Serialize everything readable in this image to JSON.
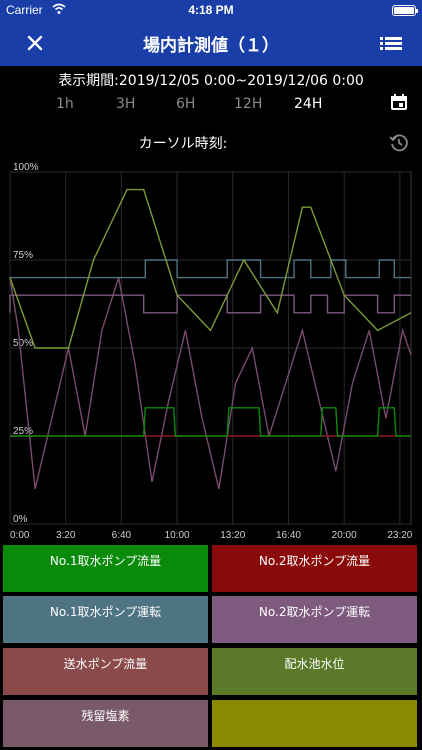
{
  "status_bar": {
    "carrier": "Carrier",
    "time": "4:18 PM"
  },
  "nav": {
    "title": "場内計測値（１）",
    "close_icon": "close-icon",
    "menu_icon": "list-icon"
  },
  "period": {
    "label": "表示期間:2019/12/05 0:00~2019/12/06 0:00"
  },
  "ranges": [
    {
      "label": "1h",
      "active": false
    },
    {
      "label": "3H",
      "active": false
    },
    {
      "label": "6H",
      "active": false
    },
    {
      "label": "12H",
      "active": false
    },
    {
      "label": "24H",
      "active": true
    }
  ],
  "cursor": {
    "label": "カーソル時刻:"
  },
  "icons": {
    "calendar": "calendar-icon",
    "refresh": "history-icon"
  },
  "chart_data": {
    "type": "line",
    "yticks": [
      "100%",
      "75%",
      "50%",
      "25%",
      "0%"
    ],
    "ylim": [
      0,
      100
    ],
    "xticks": [
      "0:00",
      "3:20",
      "6:40",
      "10:00",
      "13:20",
      "16:40",
      "20:00",
      "23:20"
    ],
    "xlim_hours": [
      0,
      24
    ],
    "grid": true,
    "series": [
      {
        "color": "#7a4a6e",
        "values_pct_at_hours": [
          [
            0,
            70
          ],
          [
            0.5,
            55
          ],
          [
            1.5,
            10
          ],
          [
            2.5,
            30
          ],
          [
            3.5,
            50
          ],
          [
            4.5,
            25
          ],
          [
            5.5,
            55
          ],
          [
            6.5,
            70
          ],
          [
            7.5,
            45
          ],
          [
            8.5,
            12
          ],
          [
            9.5,
            35
          ],
          [
            10.5,
            55
          ],
          [
            11.5,
            30
          ],
          [
            12.5,
            10
          ],
          [
            13.5,
            40
          ],
          [
            14.5,
            50
          ],
          [
            15.5,
            25
          ],
          [
            16.5,
            40
          ],
          [
            17.5,
            55
          ],
          [
            18.5,
            35
          ],
          [
            19.5,
            15
          ],
          [
            20.5,
            40
          ],
          [
            21.5,
            55
          ],
          [
            22.5,
            30
          ],
          [
            23.5,
            55
          ],
          [
            24,
            48
          ]
        ]
      },
      {
        "color": "#8a1a1a",
        "values_pct_at_hours": [
          [
            0,
            25
          ],
          [
            24,
            25
          ]
        ]
      },
      {
        "color": "#0a8a0a",
        "values_pct_at_hours": [
          [
            0,
            25
          ],
          [
            8,
            25
          ],
          [
            8.1,
            33
          ],
          [
            9.8,
            33
          ],
          [
            9.9,
            25
          ],
          [
            13,
            25
          ],
          [
            13.1,
            33
          ],
          [
            14.9,
            33
          ],
          [
            15,
            25
          ],
          [
            18.6,
            25
          ],
          [
            18.7,
            33
          ],
          [
            19.5,
            33
          ],
          [
            19.6,
            25
          ],
          [
            22,
            25
          ],
          [
            22.1,
            33
          ],
          [
            23,
            33
          ],
          [
            23.1,
            25
          ],
          [
            24,
            25
          ]
        ]
      },
      {
        "color": "#4e7382",
        "values_pct_at_hours": [
          [
            0,
            70
          ],
          [
            8.1,
            70
          ],
          [
            8.1,
            75
          ],
          [
            10,
            75
          ],
          [
            10,
            70
          ],
          [
            13,
            70
          ],
          [
            13,
            75
          ],
          [
            15,
            75
          ],
          [
            15,
            70
          ],
          [
            17,
            70
          ],
          [
            17,
            75
          ],
          [
            18,
            75
          ],
          [
            18,
            70
          ],
          [
            19.2,
            70
          ],
          [
            19.2,
            75
          ],
          [
            20.1,
            75
          ],
          [
            20.1,
            70
          ],
          [
            22.1,
            70
          ],
          [
            22.1,
            75
          ],
          [
            23,
            75
          ],
          [
            23,
            70
          ],
          [
            24,
            70
          ]
        ]
      },
      {
        "color": "#7d5a7e",
        "values_pct_at_hours": [
          [
            0,
            60
          ],
          [
            0,
            65
          ],
          [
            8,
            65
          ],
          [
            8,
            60
          ],
          [
            10,
            60
          ],
          [
            10,
            65
          ],
          [
            13,
            65
          ],
          [
            13,
            60
          ],
          [
            15,
            60
          ],
          [
            15,
            65
          ],
          [
            17,
            65
          ],
          [
            17,
            60
          ],
          [
            18,
            60
          ],
          [
            18,
            65
          ],
          [
            19,
            65
          ],
          [
            19,
            60
          ],
          [
            20,
            60
          ],
          [
            20,
            65
          ],
          [
            22,
            65
          ],
          [
            22,
            60
          ],
          [
            23,
            60
          ],
          [
            23,
            65
          ],
          [
            24,
            65
          ]
        ]
      },
      {
        "color": "#7a9a3a",
        "values_pct_at_hours": [
          [
            0,
            70
          ],
          [
            1.5,
            50
          ],
          [
            3.5,
            50
          ],
          [
            5,
            75
          ],
          [
            7,
            95
          ],
          [
            8,
            95
          ],
          [
            10,
            65
          ],
          [
            12,
            55
          ],
          [
            14,
            75
          ],
          [
            16,
            60
          ],
          [
            17.5,
            90
          ],
          [
            18,
            90
          ],
          [
            20,
            65
          ],
          [
            22,
            55
          ],
          [
            24,
            60
          ]
        ]
      }
    ]
  },
  "legend": [
    {
      "label": "No.1取水ポンプ流量",
      "color": "#0a8a0a"
    },
    {
      "label": "No.2取水ポンプ流量",
      "color": "#8a0a0a"
    },
    {
      "label": "No.1取水ポンプ運転",
      "color": "#4e7382"
    },
    {
      "label": "No.2取水ポンプ運転",
      "color": "#7d5a7e"
    },
    {
      "label": "送水ポンプ流量",
      "color": "#8a4a4a"
    },
    {
      "label": "配水池水位",
      "color": "#5a7a2a"
    },
    {
      "label": "残留塩素",
      "color": "#7a5a6a"
    },
    {
      "label": "",
      "color": "#8a8a00"
    }
  ]
}
